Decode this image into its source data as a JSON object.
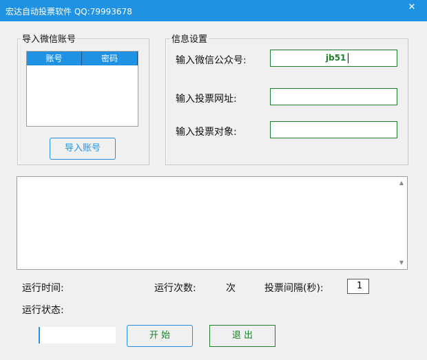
{
  "window": {
    "title": "宏达自动投票软件  QQ:79993678",
    "close_glyph": "✕"
  },
  "account_group": {
    "label": "导入微信账号",
    "columns": [
      "账号",
      "密码"
    ],
    "import_button": "导入账号"
  },
  "settings_group": {
    "label": "信息设置",
    "fields": [
      {
        "label": "输入微信公众号:",
        "value": "jb51"
      },
      {
        "label": "输入投票网址:",
        "value": ""
      },
      {
        "label": "输入投票对象:",
        "value": ""
      }
    ]
  },
  "status": {
    "run_time_label": "运行时间:",
    "run_count_label": "运行次数:",
    "count_unit": "次",
    "interval_label": "投票间隔(秒):",
    "interval_value": "1",
    "state_label": "运行状态:"
  },
  "buttons": {
    "start": "开  始",
    "exit": "退  出"
  },
  "colors": {
    "titlebar": "#1f92e4",
    "header": "#1f92e4",
    "field_border": "#1a7f2b",
    "value_text": "#1a7f2b",
    "start_border": "#1f92e4",
    "exit_border": "#1a7f2b"
  }
}
